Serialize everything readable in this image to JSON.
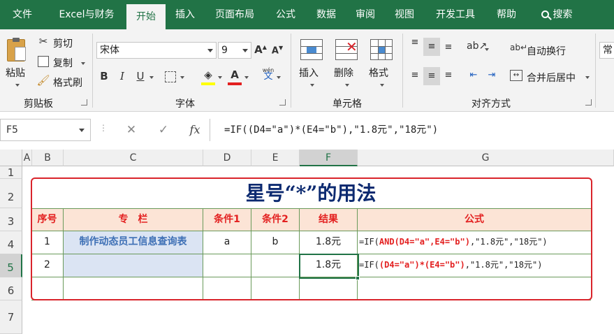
{
  "tabs": [
    "文件",
    "Excel与财务",
    "开始",
    "插入",
    "页面布局",
    "公式",
    "数据",
    "审阅",
    "视图",
    "开发工具",
    "帮助"
  ],
  "search_label": "搜索",
  "clipboard": {
    "paste": "粘贴",
    "cut": "剪切",
    "copy": "复制",
    "format_painter": "格式刷",
    "group": "剪贴板"
  },
  "font": {
    "name": "宋体",
    "size": "9",
    "group": "字体",
    "phonetic_top": "wén",
    "phonetic_bottom": "文"
  },
  "cells_group": {
    "insert": "插入",
    "delete": "删除",
    "format": "格式",
    "group": "单元格"
  },
  "alignment": {
    "wrap": "自动换行",
    "merge": "合并后居中",
    "group": "对齐方式"
  },
  "number_group_partial": "常",
  "namebox": "F5",
  "formula_bar": "=IF((D4=\"a\")*(E4=\"b\"),\"1.8元\",\"18元\")",
  "columns": [
    "A",
    "B",
    "C",
    "D",
    "E",
    "F",
    "G"
  ],
  "rows": [
    "1",
    "2",
    "3",
    "4",
    "5",
    "6",
    "7"
  ],
  "sheet": {
    "title": "星号“*”的用法",
    "headers": [
      "序号",
      "专　栏",
      "条件1",
      "条件2",
      "结果",
      "公式"
    ],
    "row1": {
      "no": "1",
      "topic": "制作动态员工信息查询表",
      "c1": "a",
      "c2": "b",
      "result": "1.8元",
      "f_pre": "=IF(",
      "f_red": "AND(D4=\"a\",E4=\"b\")",
      "f_post": ",\"1.8元\",\"18元\")"
    },
    "row2": {
      "no": "2",
      "topic": "",
      "c1": "",
      "c2": "",
      "result": "1.8元",
      "f_pre": "=IF(",
      "f_red": "(D4=\"a\")*(E4=\"b\")",
      "f_post": ",\"1.8元\",\"18元\")"
    }
  }
}
